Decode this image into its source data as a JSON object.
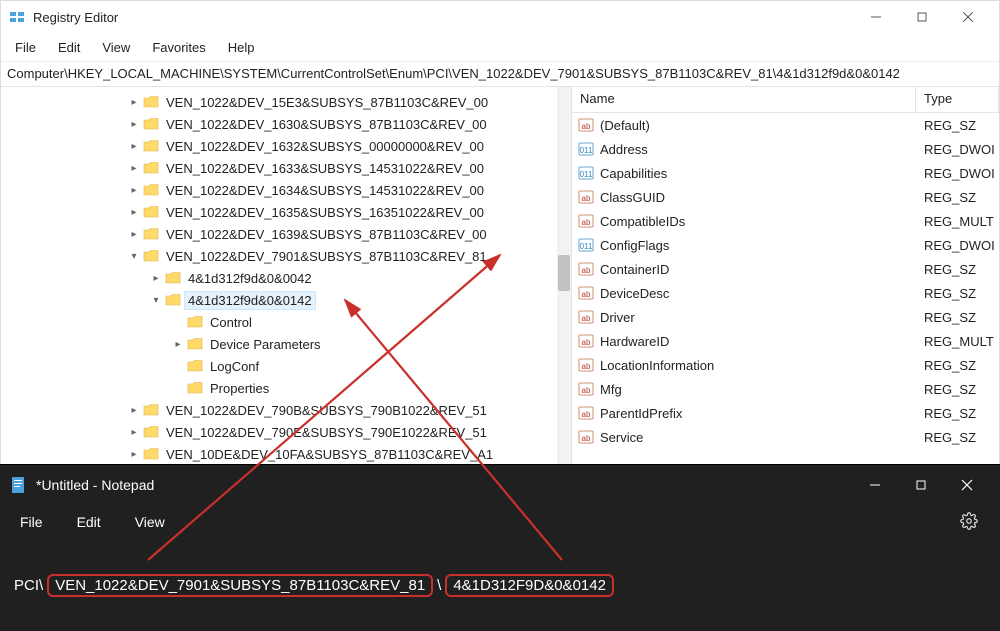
{
  "regedit": {
    "title": "Registry Editor",
    "menu": [
      "File",
      "Edit",
      "View",
      "Favorites",
      "Help"
    ],
    "address": "Computer\\HKEY_LOCAL_MACHINE\\SYSTEM\\CurrentControlSet\\Enum\\PCI\\VEN_1022&DEV_7901&SUBSYS_87B1103C&REV_81\\4&1d312f9d&0&0142",
    "tree": [
      {
        "indent": 126,
        "chev": ">",
        "label": "VEN_1022&DEV_15E3&SUBSYS_87B1103C&REV_00"
      },
      {
        "indent": 126,
        "chev": ">",
        "label": "VEN_1022&DEV_1630&SUBSYS_87B1103C&REV_00"
      },
      {
        "indent": 126,
        "chev": ">",
        "label": "VEN_1022&DEV_1632&SUBSYS_00000000&REV_00"
      },
      {
        "indent": 126,
        "chev": ">",
        "label": "VEN_1022&DEV_1633&SUBSYS_14531022&REV_00"
      },
      {
        "indent": 126,
        "chev": ">",
        "label": "VEN_1022&DEV_1634&SUBSYS_14531022&REV_00"
      },
      {
        "indent": 126,
        "chev": ">",
        "label": "VEN_1022&DEV_1635&SUBSYS_16351022&REV_00"
      },
      {
        "indent": 126,
        "chev": ">",
        "label": "VEN_1022&DEV_1639&SUBSYS_87B1103C&REV_00"
      },
      {
        "indent": 126,
        "chev": "v",
        "label": "VEN_1022&DEV_7901&SUBSYS_87B1103C&REV_81"
      },
      {
        "indent": 148,
        "chev": ">",
        "label": "4&1d312f9d&0&0042"
      },
      {
        "indent": 148,
        "chev": "v",
        "label": "4&1d312f9d&0&0142",
        "selected": true
      },
      {
        "indent": 170,
        "chev": "",
        "label": "Control"
      },
      {
        "indent": 170,
        "chev": ">",
        "label": "Device Parameters"
      },
      {
        "indent": 170,
        "chev": "",
        "label": "LogConf"
      },
      {
        "indent": 170,
        "chev": "",
        "label": "Properties"
      },
      {
        "indent": 126,
        "chev": ">",
        "label": "VEN_1022&DEV_790B&SUBSYS_790B1022&REV_51"
      },
      {
        "indent": 126,
        "chev": ">",
        "label": "VEN_1022&DEV_790E&SUBSYS_790E1022&REV_51"
      },
      {
        "indent": 126,
        "chev": ">",
        "label": "VEN_10DE&DEV_10FA&SUBSYS_87B1103C&REV_A1"
      }
    ],
    "columns": {
      "name": "Name",
      "type": "Type"
    },
    "values": [
      {
        "icon": "sz",
        "name": "(Default)",
        "type": "REG_SZ"
      },
      {
        "icon": "dw",
        "name": "Address",
        "type": "REG_DWOI"
      },
      {
        "icon": "dw",
        "name": "Capabilities",
        "type": "REG_DWOI"
      },
      {
        "icon": "sz",
        "name": "ClassGUID",
        "type": "REG_SZ"
      },
      {
        "icon": "sz",
        "name": "CompatibleIDs",
        "type": "REG_MULT"
      },
      {
        "icon": "dw",
        "name": "ConfigFlags",
        "type": "REG_DWOI"
      },
      {
        "icon": "sz",
        "name": "ContainerID",
        "type": "REG_SZ"
      },
      {
        "icon": "sz",
        "name": "DeviceDesc",
        "type": "REG_SZ"
      },
      {
        "icon": "sz",
        "name": "Driver",
        "type": "REG_SZ"
      },
      {
        "icon": "sz",
        "name": "HardwareID",
        "type": "REG_MULT"
      },
      {
        "icon": "sz",
        "name": "LocationInformation",
        "type": "REG_SZ"
      },
      {
        "icon": "sz",
        "name": "Mfg",
        "type": "REG_SZ"
      },
      {
        "icon": "sz",
        "name": "ParentIdPrefix",
        "type": "REG_SZ"
      },
      {
        "icon": "sz",
        "name": "Service",
        "type": "REG_SZ"
      }
    ]
  },
  "notepad": {
    "title": "*Untitled - Notepad",
    "menu": [
      "File",
      "Edit",
      "View"
    ],
    "line_prefix": "PCI\\",
    "seg1": "VEN_1022&DEV_7901&SUBSYS_87B1103C&REV_81",
    "sep": "\\",
    "seg2": "4&1D312F9D&0&0142"
  }
}
